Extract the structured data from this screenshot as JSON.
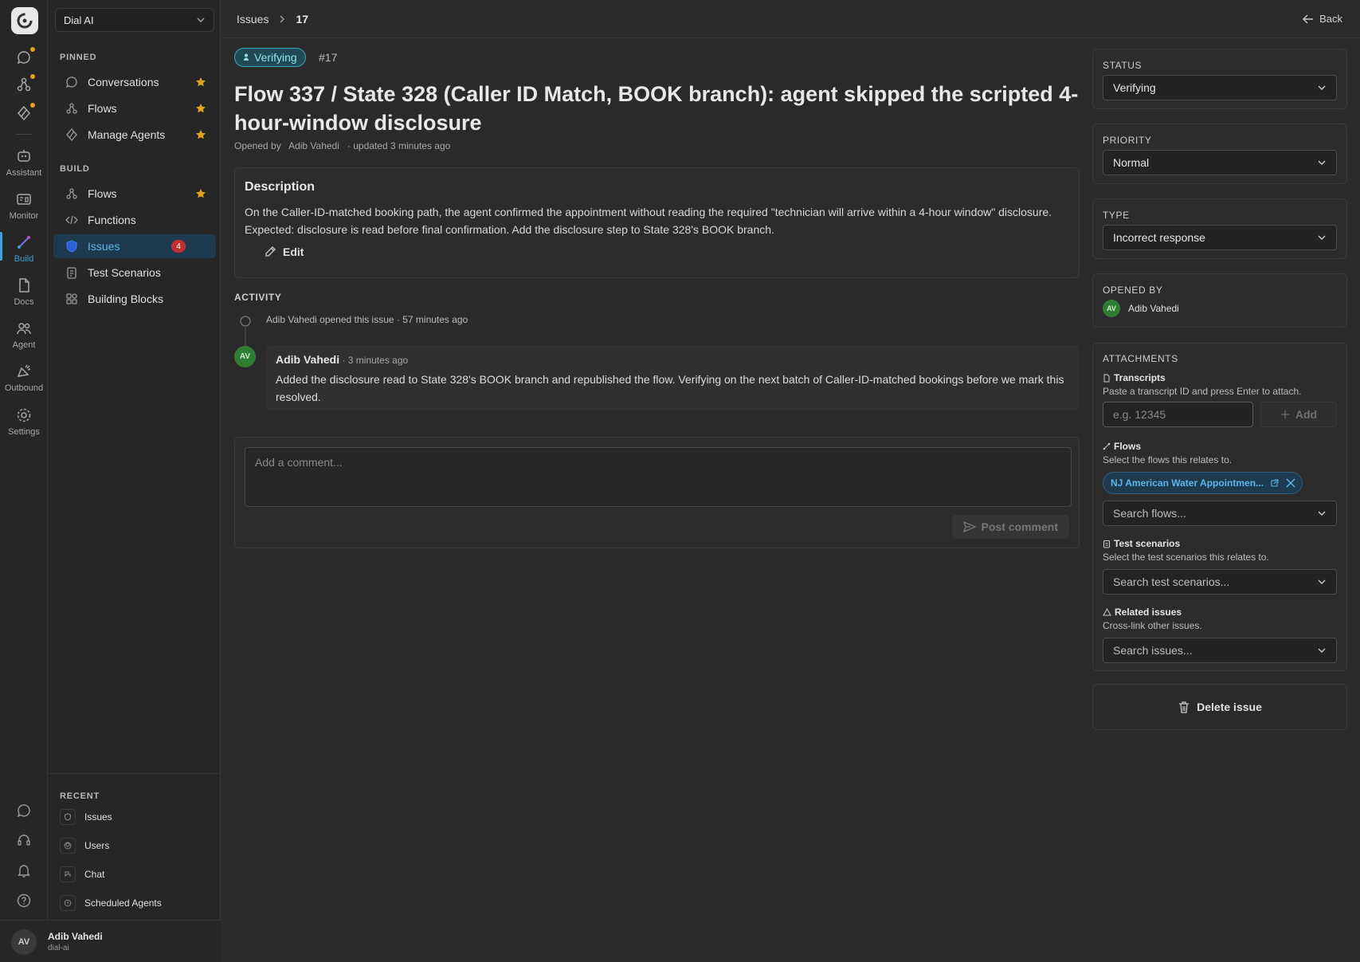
{
  "workspace": {
    "name": "Dial AI"
  },
  "rail": {
    "items": [
      {
        "label": "",
        "icon": "chat-icon"
      },
      {
        "label": "",
        "icon": "flows-icon"
      },
      {
        "label": "",
        "icon": "agents-icon"
      },
      {
        "label": "Assistant",
        "icon": "assistant-icon"
      },
      {
        "label": "Monitor",
        "icon": "monitor-icon"
      },
      {
        "label": "Build",
        "icon": "build-icon"
      },
      {
        "label": "Docs",
        "icon": "docs-icon"
      },
      {
        "label": "Agent",
        "icon": "agent-icon"
      },
      {
        "label": "Outbound",
        "icon": "outbound-icon"
      },
      {
        "label": "Settings",
        "icon": "settings-icon"
      }
    ]
  },
  "sidebar": {
    "pinned_title": "PINNED",
    "pinned": [
      {
        "label": "Conversations"
      },
      {
        "label": "Flows"
      },
      {
        "label": "Manage Agents"
      }
    ],
    "build_title": "BUILD",
    "build": [
      {
        "label": "Flows"
      },
      {
        "label": "Functions"
      },
      {
        "label": "Issues",
        "badge": "4"
      },
      {
        "label": "Test Scenarios"
      },
      {
        "label": "Building Blocks"
      }
    ],
    "recent_title": "RECENT",
    "recent": [
      {
        "label": "Issues"
      },
      {
        "label": "Users"
      },
      {
        "label": "Chat"
      },
      {
        "label": "Scheduled Agents"
      }
    ]
  },
  "user": {
    "initials": "AV",
    "name": "Adib Vahedi",
    "org": "dial-ai"
  },
  "header": {
    "crumb_parent": "Issues",
    "crumb_current": "17",
    "back_label": "Back"
  },
  "issue": {
    "status": "Verifying",
    "number": "#17",
    "title": "Flow 337 / State 328 (Caller ID Match, BOOK branch): agent skipped the scripted 4-hour-window disclosure",
    "opened_by_label": "Opened by",
    "opened_by": "Adib Vahedi",
    "updated": "· updated 3 minutes ago",
    "description_title": "Description",
    "description": "On the Caller-ID-matched booking path, the agent confirmed the appointment without reading the required \"technician will arrive within a 4-hour window\" disclosure. Expected: disclosure is read before final confirmation. Add the disclosure step to State 328's BOOK branch.",
    "edit_label": "Edit"
  },
  "activity": {
    "title": "ACTIVITY",
    "opened_event": "Adib Vahedi opened this issue · 57 minutes ago",
    "comment": {
      "initials": "AV",
      "author": "Adib Vahedi",
      "time": " · 3 minutes ago",
      "body": "Added the disclosure read to State 328's BOOK branch and republished the flow. Verifying on the next batch of Caller-ID-matched bookings before we mark this resolved."
    },
    "comment_placeholder": "Add a comment...",
    "post_label": "Post comment"
  },
  "details": {
    "status_label": "STATUS",
    "status_value": "Verifying",
    "priority_label": "PRIORITY",
    "priority_value": "Normal",
    "type_label": "TYPE",
    "type_value": "Incorrect response",
    "opened_by_label": "OPENED BY",
    "opened_by_initials": "AV",
    "opened_by_name": "Adib Vahedi"
  },
  "attachments": {
    "title": "ATTACHMENTS",
    "transcripts_title": "Transcripts",
    "transcripts_desc": "Paste a transcript ID and press Enter to attach.",
    "transcripts_placeholder": "e.g. 12345",
    "add_label": "Add",
    "flows_title": "Flows",
    "flows_desc": "Select the flows this relates to.",
    "flow_chip": "NJ American Water Appointmen...",
    "flows_search": "Search flows...",
    "tests_title": "Test scenarios",
    "tests_desc": "Select the test scenarios this relates to.",
    "tests_search": "Search test scenarios...",
    "related_title": "Related issues",
    "related_desc": "Cross-link other issues.",
    "related_search": "Search issues..."
  },
  "delete_label": "Delete issue",
  "colors": {
    "accent": "#3fa0d8",
    "status_teal": "#3fa5b5",
    "star": "#e6a020",
    "badge": "#c03030",
    "avatar_green": "#2e7d32"
  }
}
